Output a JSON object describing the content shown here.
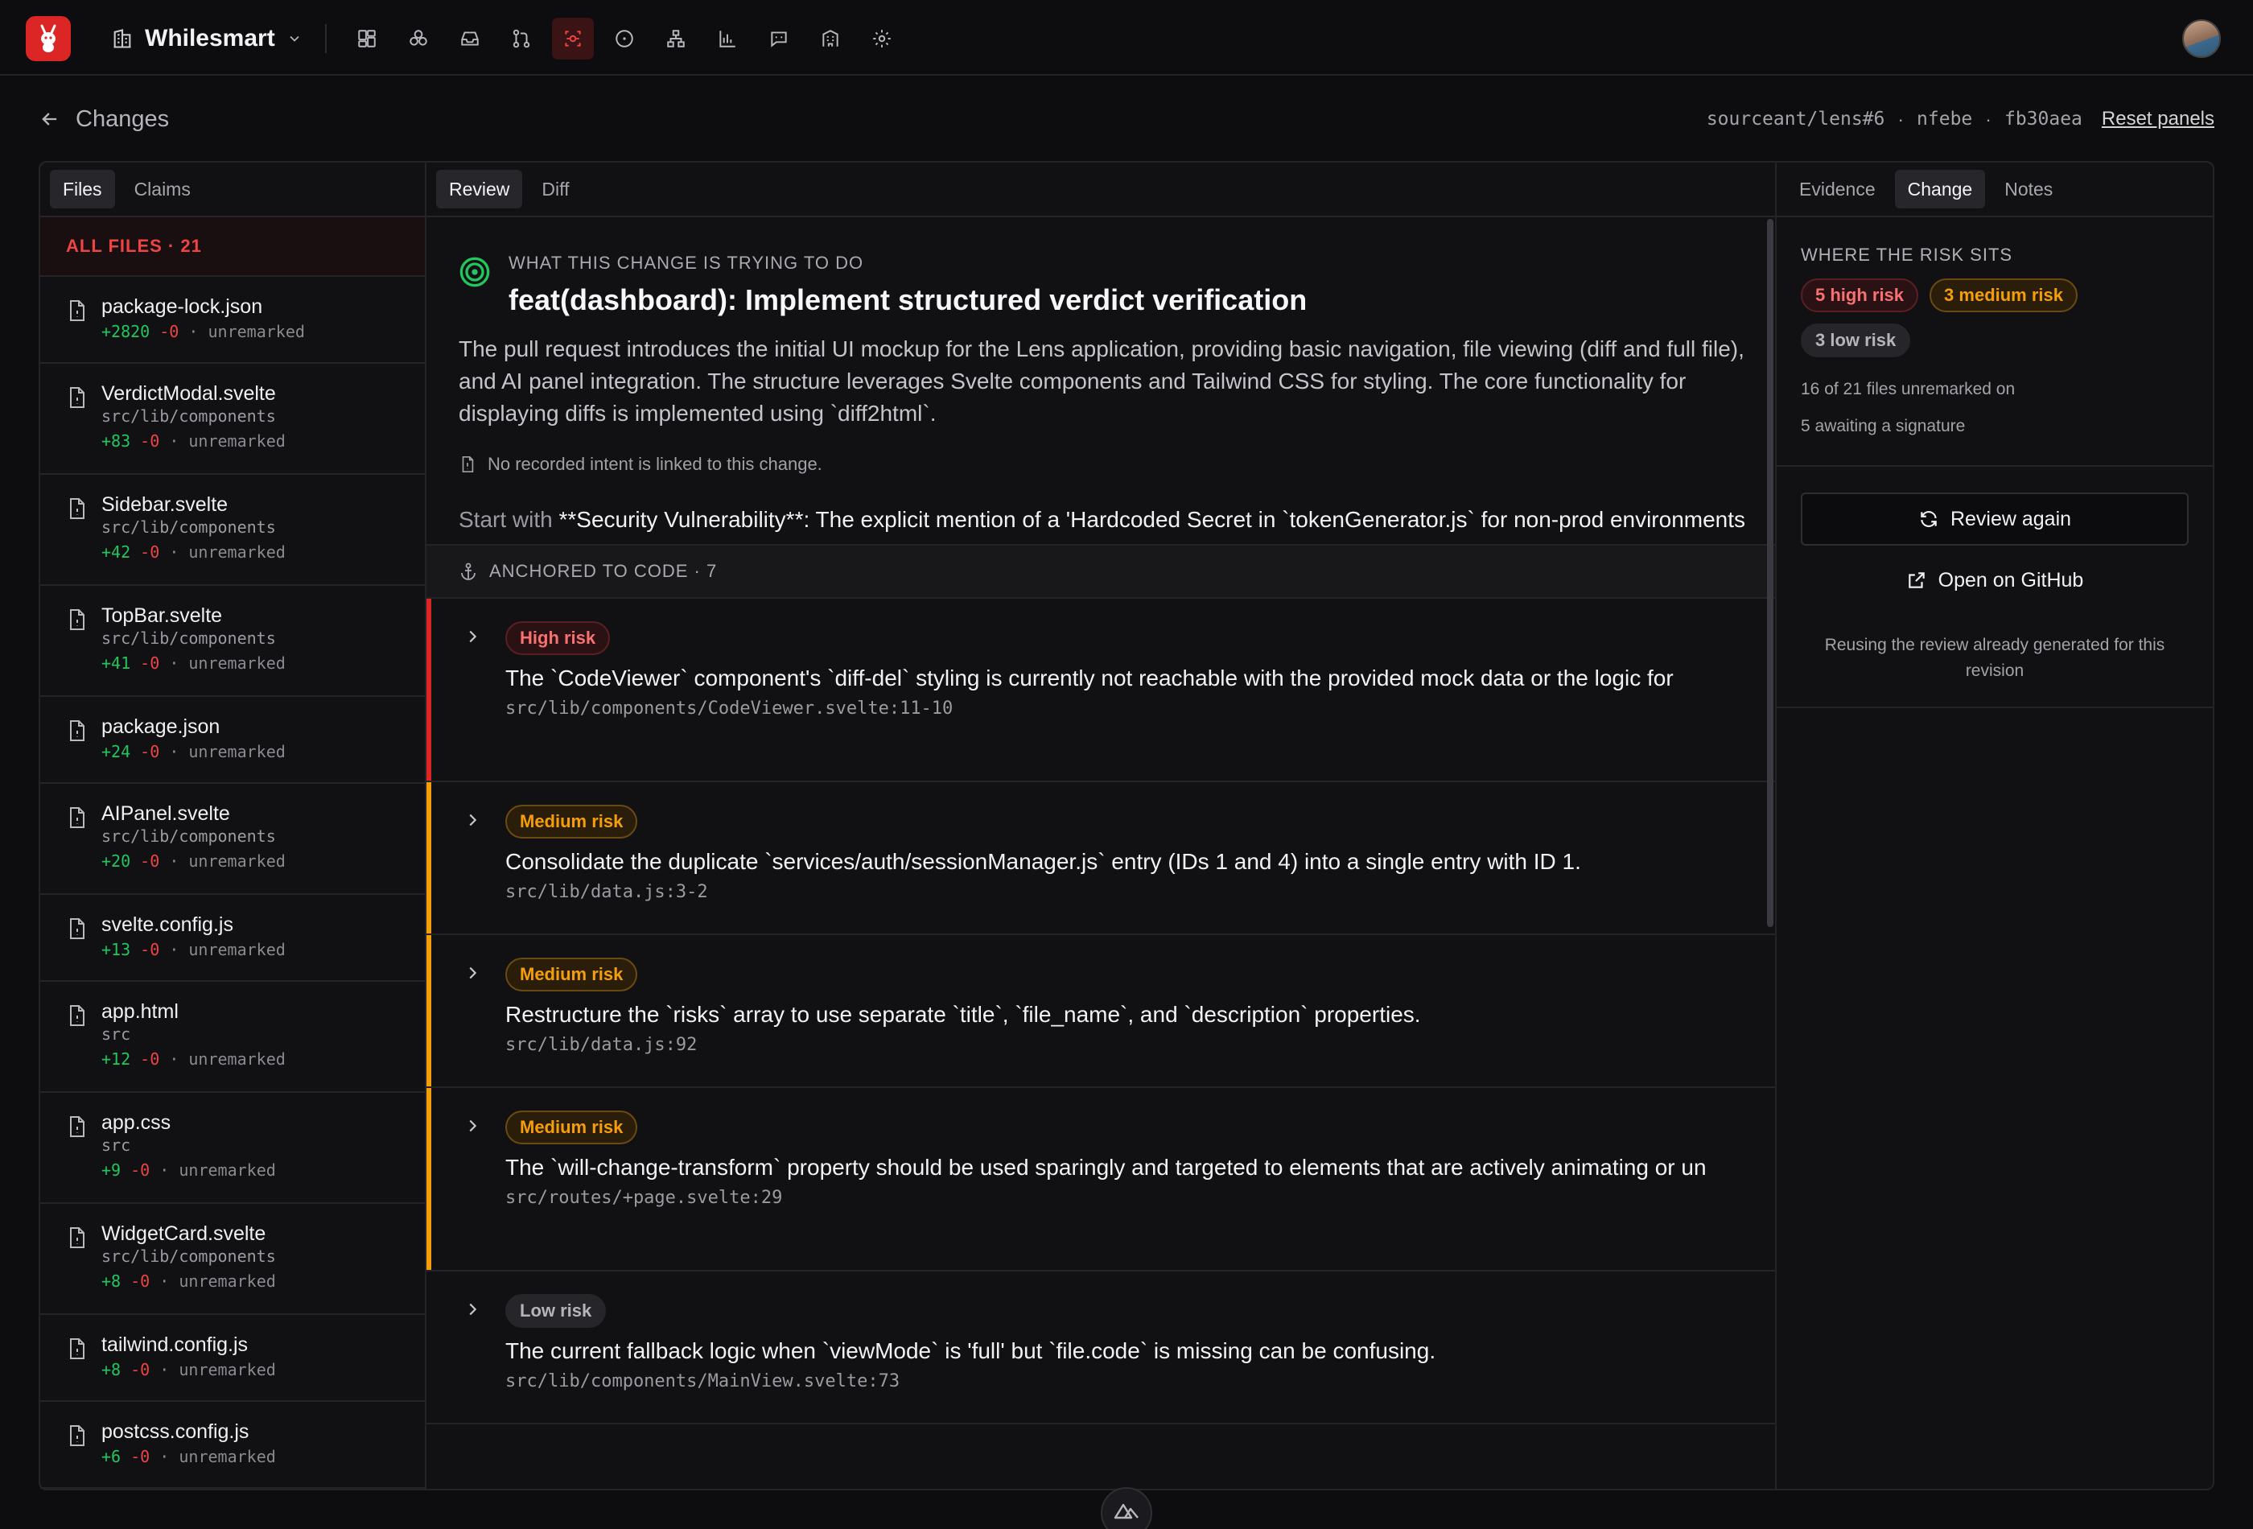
{
  "topbar": {
    "workspace": "Whilesmart",
    "nav_icons": [
      "dashboard-icon",
      "graph-icon",
      "inbox-icon",
      "pull-request-icon",
      "radar-icon",
      "circle-icon",
      "hierarchy-icon",
      "chart-icon",
      "chat-icon",
      "building-icon",
      "gear-icon"
    ],
    "active_icon": "radar-icon"
  },
  "breadcrumb": {
    "back_label": "Changes"
  },
  "meta": {
    "repo": "sourceant/lens#6",
    "sep": "·",
    "author": "nfebe",
    "sha": "fb30aea",
    "reset": "Reset panels"
  },
  "left": {
    "tabs": [
      "Files",
      "Claims"
    ],
    "all_files": "ALL FILES · 21",
    "files": [
      {
        "name": "package-lock.json",
        "dir": "",
        "add": "+2820",
        "del": "-0",
        "status": "· unremarked"
      },
      {
        "name": "VerdictModal.svelte",
        "dir": "src/lib/components",
        "add": "+83",
        "del": "-0",
        "status": "· unremarked"
      },
      {
        "name": "Sidebar.svelte",
        "dir": "src/lib/components",
        "add": "+42",
        "del": "-0",
        "status": "· unremarked"
      },
      {
        "name": "TopBar.svelte",
        "dir": "src/lib/components",
        "add": "+41",
        "del": "-0",
        "status": "· unremarked"
      },
      {
        "name": "package.json",
        "dir": "",
        "add": "+24",
        "del": "-0",
        "status": "· unremarked"
      },
      {
        "name": "AIPanel.svelte",
        "dir": "src/lib/components",
        "add": "+20",
        "del": "-0",
        "status": "· unremarked"
      },
      {
        "name": "svelte.config.js",
        "dir": "",
        "add": "+13",
        "del": "-0",
        "status": "· unremarked"
      },
      {
        "name": "app.html",
        "dir": "src",
        "add": "+12",
        "del": "-0",
        "status": "· unremarked"
      },
      {
        "name": "app.css",
        "dir": "src",
        "add": "+9",
        "del": "-0",
        "status": "· unremarked"
      },
      {
        "name": "WidgetCard.svelte",
        "dir": "src/lib/components",
        "add": "+8",
        "del": "-0",
        "status": "· unremarked"
      },
      {
        "name": "tailwind.config.js",
        "dir": "",
        "add": "+8",
        "del": "-0",
        "status": "· unremarked"
      },
      {
        "name": "postcss.config.js",
        "dir": "",
        "add": "+6",
        "del": "-0",
        "status": "· unremarked"
      }
    ]
  },
  "center": {
    "tabs": [
      "Review",
      "Diff"
    ],
    "eyebrow": "WHAT THIS CHANGE IS TRYING TO DO",
    "title": "feat(dashboard): Implement structured verdict verification",
    "description": "The pull request introduces the initial UI mockup for the Lens application, providing basic navigation, file viewing (diff and full file), and AI panel integration. The structure leverages Svelte components and Tailwind CSS for styling. The core functionality for displaying diffs is implemented using `diff2html`.",
    "no_intent": "No recorded intent is linked to this change.",
    "start_prefix": "Start with ",
    "start_body": "**Security Vulnerability**: The explicit mention of a 'Hardcoded Secret in `tokenGenerator.js` for non-prod environments",
    "anchored": "ANCHORED TO CODE · 7",
    "risks": [
      {
        "level": "high",
        "label": "High risk",
        "title": "The `CodeViewer` component's `diff-del` styling is currently not reachable with the provided mock data or the logic for",
        "loc": "src/lib/components/CodeViewer.svelte:11-10"
      },
      {
        "level": "medium",
        "label": "Medium risk",
        "title": "Consolidate the duplicate `services/auth/sessionManager.js` entry (IDs 1 and 4) into a single entry with ID 1.",
        "loc": "src/lib/data.js:3-2"
      },
      {
        "level": "medium",
        "label": "Medium risk",
        "title": "Restructure the `risks` array to use separate `title`, `file_name`, and `description` properties.",
        "loc": "src/lib/data.js:92"
      },
      {
        "level": "medium",
        "label": "Medium risk",
        "title": "The `will-change-transform` property should be used sparingly and targeted to elements that are actively animating or un",
        "loc": "src/routes/+page.svelte:29"
      },
      {
        "level": "low",
        "label": "Low risk",
        "title": "The current fallback logic when `viewMode` is 'full' but `file.code` is missing can be confusing.",
        "loc": "src/lib/components/MainView.svelte:73"
      }
    ]
  },
  "right": {
    "tabs": [
      "Evidence",
      "Change",
      "Notes"
    ],
    "heading": "WHERE THE RISK SITS",
    "high": "5 high risk",
    "medium": "3 medium risk",
    "low": "3 low risk",
    "unremarked": "16 of 21 files unremarked on",
    "awaiting": "5 awaiting a signature",
    "review_again": "Review again",
    "open_github": "Open on GitHub",
    "reusing": "Reusing the review already generated for this revision"
  },
  "colors": {
    "accent": "#dc2626",
    "high": "#ef4444",
    "medium": "#f59e0b",
    "low": "#3a3a40",
    "add": "#22c55e"
  }
}
